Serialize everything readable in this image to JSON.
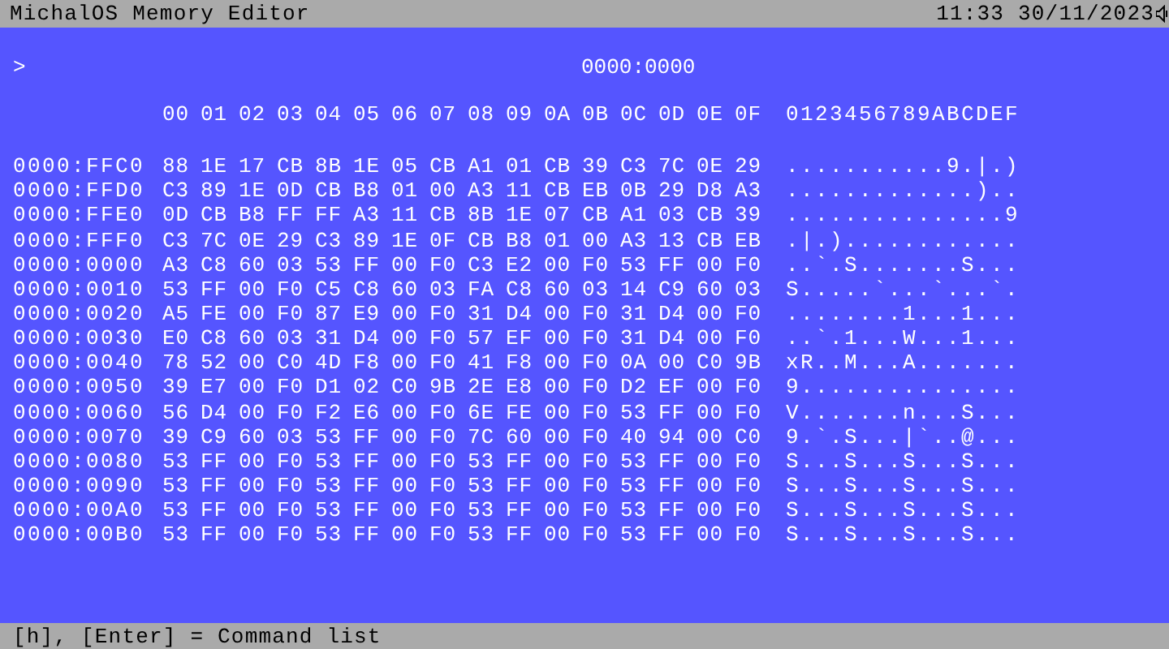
{
  "title_bar": {
    "title": "MichalOS Memory Editor",
    "clock": "11:33 30/11/2023",
    "sound_muted": false
  },
  "editor": {
    "prompt": ">",
    "address": "0000:0000",
    "column_headers": [
      "00",
      "01",
      "02",
      "03",
      "04",
      "05",
      "06",
      "07",
      "08",
      "09",
      "0A",
      "0B",
      "0C",
      "0D",
      "0E",
      "0F"
    ],
    "ascii_header": "0123456789ABCDEF",
    "rows": [
      {
        "address": "0000:FFC0",
        "bytes": [
          "88",
          "1E",
          "17",
          "CB",
          "8B",
          "1E",
          "05",
          "CB",
          "A1",
          "01",
          "CB",
          "39",
          "C3",
          "7C",
          "0E",
          "29"
        ],
        "ascii": "...........9.|.)"
      },
      {
        "address": "0000:FFD0",
        "bytes": [
          "C3",
          "89",
          "1E",
          "0D",
          "CB",
          "B8",
          "01",
          "00",
          "A3",
          "11",
          "CB",
          "EB",
          "0B",
          "29",
          "D8",
          "A3"
        ],
        "ascii": ".............).."
      },
      {
        "address": "0000:FFE0",
        "bytes": [
          "0D",
          "CB",
          "B8",
          "FF",
          "FF",
          "A3",
          "11",
          "CB",
          "8B",
          "1E",
          "07",
          "CB",
          "A1",
          "03",
          "CB",
          "39"
        ],
        "ascii": "...............9"
      },
      {
        "address": "0000:FFF0",
        "bytes": [
          "C3",
          "7C",
          "0E",
          "29",
          "C3",
          "89",
          "1E",
          "0F",
          "CB",
          "B8",
          "01",
          "00",
          "A3",
          "13",
          "CB",
          "EB"
        ],
        "ascii": ".|.)............"
      },
      {
        "address": "0000:0000",
        "bytes": [
          "A3",
          "C8",
          "60",
          "03",
          "53",
          "FF",
          "00",
          "F0",
          "C3",
          "E2",
          "00",
          "F0",
          "53",
          "FF",
          "00",
          "F0"
        ],
        "ascii": "..`.S.......S..."
      },
      {
        "address": "0000:0010",
        "bytes": [
          "53",
          "FF",
          "00",
          "F0",
          "C5",
          "C8",
          "60",
          "03",
          "FA",
          "C8",
          "60",
          "03",
          "14",
          "C9",
          "60",
          "03"
        ],
        "ascii": "S.....`...`...`."
      },
      {
        "address": "0000:0020",
        "bytes": [
          "A5",
          "FE",
          "00",
          "F0",
          "87",
          "E9",
          "00",
          "F0",
          "31",
          "D4",
          "00",
          "F0",
          "31",
          "D4",
          "00",
          "F0"
        ],
        "ascii": "........1...1..."
      },
      {
        "address": "0000:0030",
        "bytes": [
          "E0",
          "C8",
          "60",
          "03",
          "31",
          "D4",
          "00",
          "F0",
          "57",
          "EF",
          "00",
          "F0",
          "31",
          "D4",
          "00",
          "F0"
        ],
        "ascii": "..`.1...W...1..."
      },
      {
        "address": "0000:0040",
        "bytes": [
          "78",
          "52",
          "00",
          "C0",
          "4D",
          "F8",
          "00",
          "F0",
          "41",
          "F8",
          "00",
          "F0",
          "0A",
          "00",
          "C0",
          "9B"
        ],
        "ascii": "xR..M...A......."
      },
      {
        "address": "0000:0050",
        "bytes": [
          "39",
          "E7",
          "00",
          "F0",
          "D1",
          "02",
          "C0",
          "9B",
          "2E",
          "E8",
          "00",
          "F0",
          "D2",
          "EF",
          "00",
          "F0"
        ],
        "ascii": "9..............."
      },
      {
        "address": "0000:0060",
        "bytes": [
          "56",
          "D4",
          "00",
          "F0",
          "F2",
          "E6",
          "00",
          "F0",
          "6E",
          "FE",
          "00",
          "F0",
          "53",
          "FF",
          "00",
          "F0"
        ],
        "ascii": "V.......n...S..."
      },
      {
        "address": "0000:0070",
        "bytes": [
          "39",
          "C9",
          "60",
          "03",
          "53",
          "FF",
          "00",
          "F0",
          "7C",
          "60",
          "00",
          "F0",
          "40",
          "94",
          "00",
          "C0"
        ],
        "ascii": "9.`.S...|`..@..."
      },
      {
        "address": "0000:0080",
        "bytes": [
          "53",
          "FF",
          "00",
          "F0",
          "53",
          "FF",
          "00",
          "F0",
          "53",
          "FF",
          "00",
          "F0",
          "53",
          "FF",
          "00",
          "F0"
        ],
        "ascii": "S...S...S...S..."
      },
      {
        "address": "0000:0090",
        "bytes": [
          "53",
          "FF",
          "00",
          "F0",
          "53",
          "FF",
          "00",
          "F0",
          "53",
          "FF",
          "00",
          "F0",
          "53",
          "FF",
          "00",
          "F0"
        ],
        "ascii": "S...S...S...S..."
      },
      {
        "address": "0000:00A0",
        "bytes": [
          "53",
          "FF",
          "00",
          "F0",
          "53",
          "FF",
          "00",
          "F0",
          "53",
          "FF",
          "00",
          "F0",
          "53",
          "FF",
          "00",
          "F0"
        ],
        "ascii": "S...S...S...S..."
      },
      {
        "address": "0000:00B0",
        "bytes": [
          "53",
          "FF",
          "00",
          "F0",
          "53",
          "FF",
          "00",
          "F0",
          "53",
          "FF",
          "00",
          "F0",
          "53",
          "FF",
          "00",
          "F0"
        ],
        "ascii": "S...S...S...S..."
      }
    ]
  },
  "status_bar": {
    "hint": "[h], [Enter] = Command list"
  }
}
